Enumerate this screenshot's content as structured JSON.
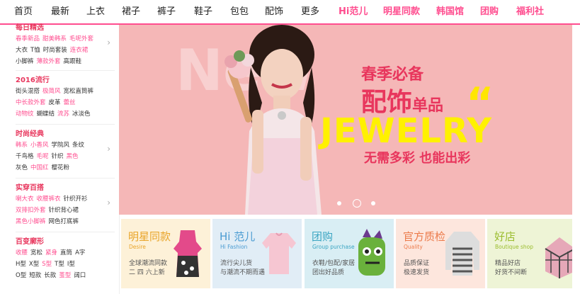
{
  "nav": {
    "items": [
      "首页",
      "最新",
      "上衣",
      "裙子",
      "裤子",
      "鞋子",
      "包包",
      "配饰",
      "更多",
      "Hi范儿",
      "明星同款",
      "韩国馆",
      "团购",
      "福利社"
    ]
  },
  "sidebar": {
    "sections": [
      {
        "title": "每日精选",
        "rows": [
          [
            "春季新品",
            "甜美韩系",
            "毛呢外套"
          ],
          [
            "大衣",
            "T恤",
            "时尚套装",
            "连衣裙"
          ],
          [
            "小脚裤",
            "薄款外套",
            "高跟鞋"
          ]
        ]
      },
      {
        "title": "2016流行",
        "rows": [
          [
            "街头混搭",
            "极简风",
            "宽松直筒裤"
          ],
          [
            "中长款外套",
            "皮革",
            "蕾丝"
          ],
          [
            "动物纹",
            "蝴蝶结",
            "流苏",
            "冰淡色"
          ]
        ]
      },
      {
        "title": "时尚经典",
        "rows": [
          [
            "韩系",
            "小香风",
            "学院风",
            "条纹"
          ],
          [
            "千鸟格",
            "毛呢",
            "针织",
            "黑色"
          ],
          [
            "灰色",
            "中国红",
            "樱花粉"
          ]
        ]
      },
      {
        "title": "实穿百搭",
        "rows": [
          [
            "喇大衣",
            "收腰裤衣",
            "针织开衫"
          ],
          [
            "双排扣外套",
            "针织背心裙"
          ],
          [
            "黑色小脚裤",
            "网色打底裤"
          ]
        ]
      },
      {
        "title": "百变廓形",
        "rows": [
          [
            "收腰",
            "宽松",
            "紧身",
            "直筒",
            "A字"
          ],
          [
            "H型",
            "X型",
            "S型",
            "T型",
            "I型"
          ],
          [
            "O型",
            "短款",
            "长款",
            "茧型",
            "阔口"
          ]
        ]
      }
    ]
  },
  "banner": {
    "bg_word": "New",
    "headline1": "春季必备",
    "headline2_big": "配饰",
    "headline2_small": "单品",
    "quote_mark": "“",
    "headline3": "JEWELRY",
    "tagline": "无需多彩  也能出彩",
    "slide_count": 3,
    "active_slide": 2
  },
  "cards": [
    {
      "title": "明星同款",
      "en": "Desire",
      "lines": [
        "全球潮流同款",
        "二 四 六上新"
      ],
      "bg": "#fdf1d8",
      "color": "#e9a428"
    },
    {
      "title": "Hi 范儿",
      "en": "Hi Fashion",
      "lines": [
        "流行尖儿货",
        "与潮流不期而遇"
      ],
      "bg": "#e1edf6",
      "color": "#4a9bd2"
    },
    {
      "title": "团购",
      "en": "Group purchase",
      "lines": [
        "衣鞋/包配/家居",
        "团出好品质"
      ],
      "bg": "#d9eef4",
      "color": "#3aa5c2"
    },
    {
      "title": "官方质检",
      "en": "Quality",
      "lines": [
        "品质保证",
        "极速发货"
      ],
      "bg": "#fde6dd",
      "color": "#ec7b4b"
    },
    {
      "title": "好店",
      "en": "Boutique shop",
      "lines": [
        "精品好店",
        "好货不间断"
      ],
      "bg": "#eef4d6",
      "color": "#9bbd2e"
    }
  ],
  "colors": {
    "accent": "#ff4d8f",
    "banner_bg": "#f5b7b7",
    "headline": "#e8365d",
    "jewelry": "#fff100"
  }
}
